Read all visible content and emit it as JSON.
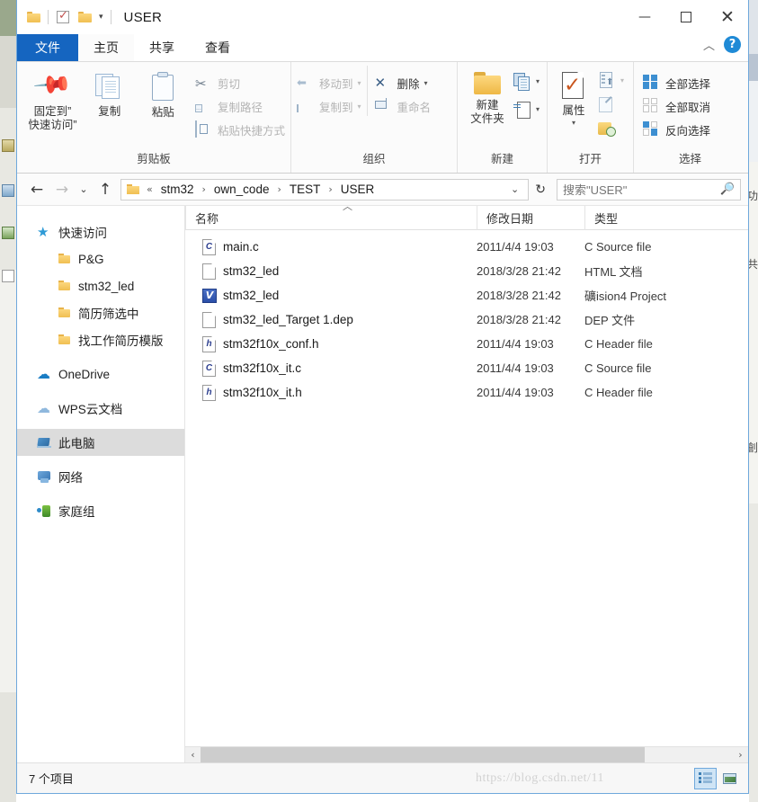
{
  "window": {
    "title": "USER",
    "quick_access": {
      "folder_icon": "folder-icon",
      "properties_check_icon": "checkbox-icon",
      "new_folder_icon": "folder-icon",
      "customize_caret": "▾"
    },
    "controls": {
      "minimize": "—",
      "maximize": "□",
      "close": "✕"
    }
  },
  "ribbon": {
    "tabs": [
      {
        "label": "文件",
        "id": "file"
      },
      {
        "label": "主页",
        "id": "home"
      },
      {
        "label": "共享",
        "id": "share"
      },
      {
        "label": "查看",
        "id": "view"
      }
    ],
    "collapse_caret": "︿",
    "help_glyph": "?",
    "groups": [
      {
        "label": "剪贴板",
        "big_buttons": [
          {
            "label": "固定到“\n快速访问”",
            "line1": "固定到”",
            "line2": "快速访问”",
            "icon": "pin-icon",
            "enabled": true
          },
          {
            "label": "复制",
            "icon": "copy-icon",
            "enabled": true
          },
          {
            "label": "粘贴",
            "icon": "paste-icon",
            "enabled": true
          }
        ],
        "small_buttons": [
          {
            "label": "剪切",
            "icon": "scissors-icon",
            "enabled": false
          },
          {
            "label": "复制路径",
            "icon": "copy-path-icon",
            "enabled": false
          },
          {
            "label": "粘贴快捷方式",
            "icon": "paste-shortcut-icon",
            "enabled": false
          }
        ]
      },
      {
        "label": "组织",
        "small_buttons": [
          {
            "label": "移动到",
            "icon": "move-to-icon",
            "caret": "▾",
            "enabled": false
          },
          {
            "label": "复制到",
            "icon": "copy-to-icon",
            "caret": "▾",
            "enabled": false
          },
          {
            "label": "删除",
            "icon": "delete-x-icon",
            "caret": "▾",
            "enabled": true
          },
          {
            "label": "重命名",
            "icon": "rename-icon",
            "enabled": false
          }
        ]
      },
      {
        "label": "新建",
        "big_buttons": [
          {
            "line1": "新建",
            "line2": "文件夹",
            "icon": "new-folder-icon",
            "enabled": true
          }
        ],
        "small_buttons": [
          {
            "label": "",
            "icon": "new-item-icon",
            "caret": "▾",
            "enabled": true
          },
          {
            "label": "",
            "icon": "easy-access-icon",
            "caret": "▾",
            "enabled": true
          }
        ]
      },
      {
        "label": "打开",
        "big_buttons": [
          {
            "line1": "属性",
            "icon": "properties-icon",
            "caret": "▾",
            "enabled": true
          }
        ],
        "small_buttons": [
          {
            "label": "",
            "icon": "open-icon",
            "caret": "▾",
            "enabled": false
          },
          {
            "label": "",
            "icon": "edit-icon",
            "enabled": false
          },
          {
            "label": "",
            "icon": "history-icon",
            "enabled": true
          }
        ]
      },
      {
        "label": "选择",
        "small_buttons": [
          {
            "label": "全部选择",
            "icon": "select-all-icon",
            "enabled": true
          },
          {
            "label": "全部取消",
            "icon": "select-none-icon",
            "enabled": true
          },
          {
            "label": "反向选择",
            "icon": "invert-selection-icon",
            "enabled": true
          }
        ]
      }
    ]
  },
  "navbar": {
    "back_glyph": "←",
    "forward_glyph": "→",
    "recent_glyph": "⌄",
    "up_glyph": "↑",
    "breadcrumb_prefix": "«",
    "breadcrumbs": [
      "stm32",
      "own_code",
      "TEST",
      "USER"
    ],
    "separator": "›",
    "dropdown_glyph": "⌄",
    "refresh_glyph": "↻",
    "search_placeholder": "搜索\"USER\"",
    "search_value": "",
    "search_icon": "search-icon"
  },
  "navpane": {
    "items": [
      {
        "label": "快速访问",
        "icon": "star-icon",
        "level": 0,
        "selected": false
      },
      {
        "label": "P&G",
        "icon": "folder-icon",
        "level": 1,
        "selected": false
      },
      {
        "label": "stm32_led",
        "icon": "folder-icon",
        "level": 1,
        "selected": false
      },
      {
        "label": "简历筛选中",
        "icon": "folder-icon",
        "level": 1,
        "selected": false
      },
      {
        "label": "找工作简历模版",
        "icon": "folder-icon",
        "level": 1,
        "selected": false
      },
      {
        "label": "OneDrive",
        "icon": "onedrive-cloud-icon",
        "level": 0,
        "selected": false
      },
      {
        "label": "WPS云文档",
        "icon": "wps-cloud-icon",
        "level": 0,
        "selected": false
      },
      {
        "label": "此电脑",
        "icon": "this-pc-icon",
        "level": 0,
        "selected": true
      },
      {
        "label": "网络",
        "icon": "network-icon",
        "level": 0,
        "selected": false
      },
      {
        "label": "家庭组",
        "icon": "homegroup-icon",
        "level": 0,
        "selected": false
      }
    ]
  },
  "filelist": {
    "columns": [
      {
        "label": "名称",
        "key": "name"
      },
      {
        "label": "修改日期",
        "key": "date"
      },
      {
        "label": "类型",
        "key": "type"
      }
    ],
    "sort_caret": "︿",
    "rows": [
      {
        "name": "main.c",
        "date": "2011/4/4 19:03",
        "type": "C Source file",
        "icon": "c-source-file-icon",
        "letter": "C"
      },
      {
        "name": "stm32_led",
        "date": "2018/3/28 21:42",
        "type": "HTML 文档",
        "icon": "generic-file-icon",
        "letter": ""
      },
      {
        "name": "stm32_led",
        "date": "2018/3/28 21:42",
        "type": "礦ision4 Project",
        "icon": "uvision-project-icon",
        "letter": "V"
      },
      {
        "name": "stm32_led_Target 1.dep",
        "date": "2018/3/28 21:42",
        "type": "DEP 文件",
        "icon": "generic-file-icon",
        "letter": ""
      },
      {
        "name": "stm32f10x_conf.h",
        "date": "2011/4/4 19:03",
        "type": "C Header file",
        "icon": "h-header-file-icon",
        "letter": "h"
      },
      {
        "name": "stm32f10x_it.c",
        "date": "2011/4/4 19:03",
        "type": "C Source file",
        "icon": "c-source-file-icon",
        "letter": "C"
      },
      {
        "name": "stm32f10x_it.h",
        "date": "2011/4/4 19:03",
        "type": "C Header file",
        "icon": "h-header-file-icon",
        "letter": "h"
      }
    ]
  },
  "hscroll": {
    "left_glyph": "‹",
    "right_glyph": "›"
  },
  "statusbar": {
    "item_count": "7 个项目",
    "watermark": "https://blog.csdn.net/11",
    "view_buttons": [
      {
        "icon": "details-view-icon",
        "active": true
      },
      {
        "icon": "thumbnails-view-icon",
        "active": false
      }
    ]
  },
  "colors": {
    "file_tab_blue": "#1565c0",
    "window_border": "#6fa8dc",
    "selection_gray": "#dcdcdc",
    "accent_blue": "#3d8fd1"
  }
}
